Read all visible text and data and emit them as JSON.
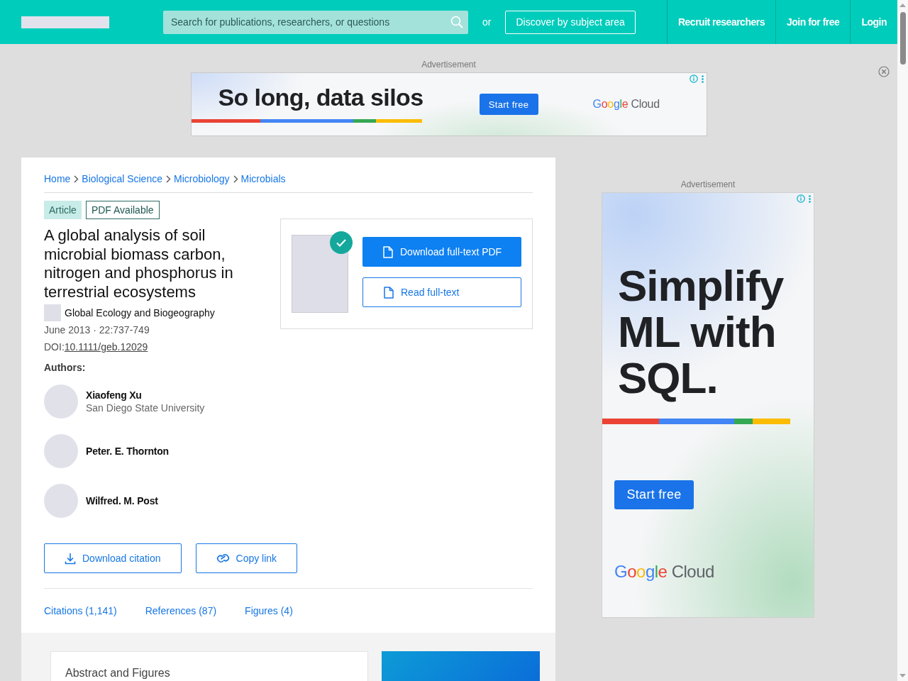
{
  "header": {
    "search": {
      "placeholder": "Search for publications, researchers, or questions"
    },
    "separator": "or",
    "discover_button": "Discover by subject area",
    "nav_links": [
      "Recruit researchers",
      "Join for free",
      "Login"
    ]
  },
  "top_ad": {
    "label": "Advertisement",
    "headline": "So long, data silos",
    "button": "Start free",
    "logo": {
      "wordmark": "Google",
      "product": "Cloud"
    }
  },
  "article": {
    "breadcrumbs": [
      "Home",
      "Biological Science",
      "Microbiology",
      "Microbials"
    ],
    "badges": [
      {
        "label": "Article",
        "kind": "filled"
      },
      {
        "label": "PDF Available",
        "kind": "outlined"
      }
    ],
    "title": "A global analysis of soil microbial biomass carbon, nitrogen and phosphorus in terrestrial ecosystems",
    "journal": "Global Ecology and Biogeography",
    "date_pages": "June 2013 · 22:737-749",
    "doi": {
      "label": "DOI:",
      "value": "10.1111/geb.12029"
    },
    "authors_label": "Authors:",
    "authors": [
      {
        "name": "Xiaofeng Xu",
        "affiliation": "San Diego State University"
      },
      {
        "name": "Peter. E. Thornton"
      },
      {
        "name": "Wilfred. M. Post"
      }
    ],
    "pdf_panel": {
      "buttons": [
        {
          "label": "Download full-text PDF",
          "kind": "primary"
        },
        {
          "label": "Read full-text",
          "kind": "secondary"
        }
      ]
    },
    "actions": [
      {
        "label": "Download citation",
        "kind": "download"
      },
      {
        "label": "Copy link",
        "kind": "link"
      }
    ],
    "tabs": [
      {
        "label": "Citations (1,141)",
        "selected": false
      },
      {
        "label": "References (87)",
        "selected": false
      },
      {
        "label": "Figures (4)",
        "selected": false
      }
    ]
  },
  "section": {
    "title": "Abstract and Figures"
  },
  "side_ad": {
    "label": "Advertisement",
    "headline": "Simplify ML with SQL.",
    "button": "Start free",
    "logo": {
      "wordmark": "Google",
      "product": "Cloud"
    }
  }
}
